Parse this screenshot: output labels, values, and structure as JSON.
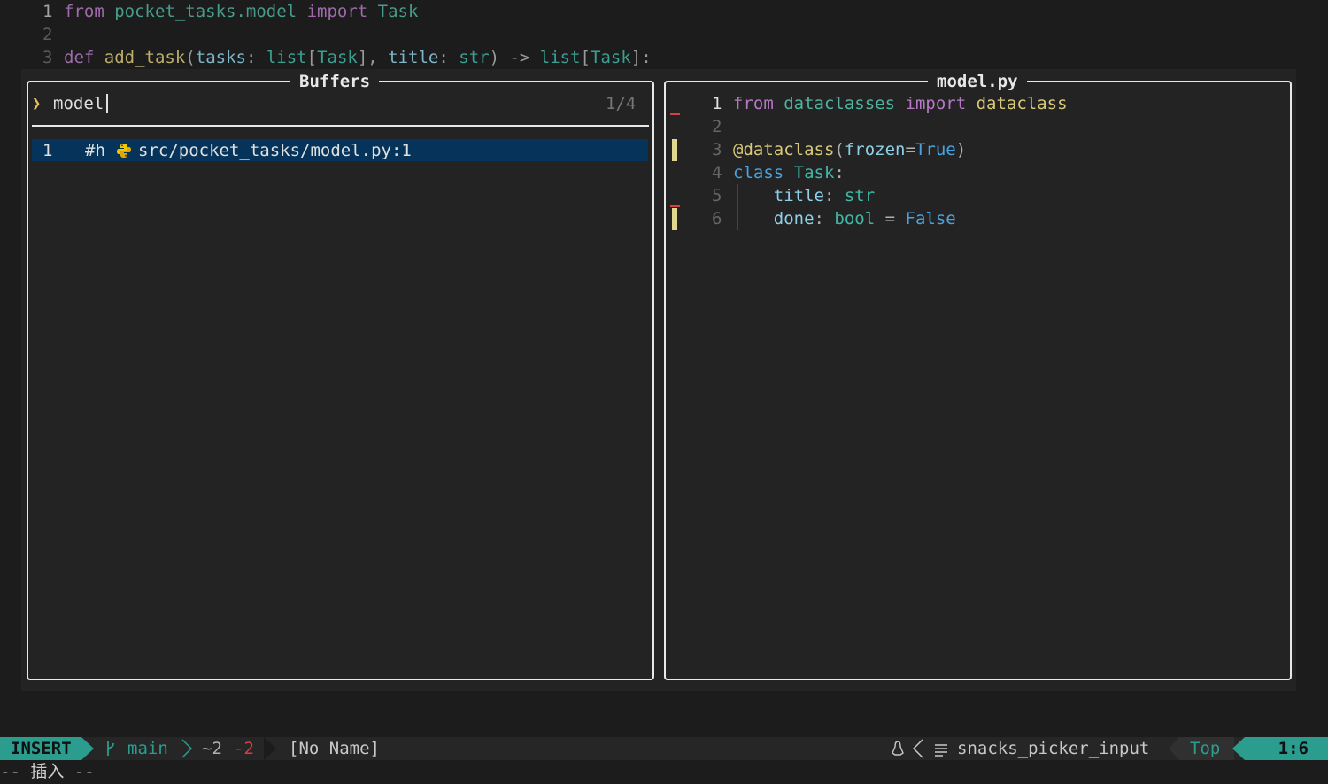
{
  "editor": {
    "lines": [
      {
        "num": "1",
        "tokens": [
          {
            "t": "from",
            "c": "kw"
          },
          {
            "t": " ",
            "c": "id"
          },
          {
            "t": "pocket_tasks.model",
            "c": "mod"
          },
          {
            "t": " ",
            "c": "id"
          },
          {
            "t": "import",
            "c": "kw"
          },
          {
            "t": " ",
            "c": "id"
          },
          {
            "t": "Task",
            "c": "mod"
          }
        ]
      },
      {
        "num": "2",
        "tokens": []
      },
      {
        "num": "3",
        "tokens": [
          {
            "t": "def",
            "c": "kw"
          },
          {
            "t": " ",
            "c": "id"
          },
          {
            "t": "add_task",
            "c": "fn"
          },
          {
            "t": "(",
            "c": "punc"
          },
          {
            "t": "tasks",
            "c": "param"
          },
          {
            "t": ": ",
            "c": "punc"
          },
          {
            "t": "list",
            "c": "ty"
          },
          {
            "t": "[",
            "c": "punc"
          },
          {
            "t": "Task",
            "c": "ty"
          },
          {
            "t": "], ",
            "c": "punc"
          },
          {
            "t": "title",
            "c": "param"
          },
          {
            "t": ": ",
            "c": "punc"
          },
          {
            "t": "str",
            "c": "ty"
          },
          {
            "t": ") -> ",
            "c": "punc"
          },
          {
            "t": "list",
            "c": "ty"
          },
          {
            "t": "[",
            "c": "punc"
          },
          {
            "t": "Task",
            "c": "ty"
          },
          {
            "t": "]:",
            "c": "punc"
          }
        ]
      }
    ]
  },
  "picker": {
    "title": "Buffers",
    "prompt_icon": "❯",
    "query": "model",
    "count": "1/4",
    "results": [
      {
        "index": "1",
        "flags": "#h",
        "icon": "python-icon",
        "path": "src/pocket_tasks/model.py:1"
      }
    ]
  },
  "preview": {
    "title": "model.py",
    "lines": [
      {
        "num": "1",
        "tokens": [
          {
            "t": "from",
            "c": "kw"
          },
          {
            "t": " ",
            "c": "id"
          },
          {
            "t": "dataclasses",
            "c": "mod"
          },
          {
            "t": " ",
            "c": "id"
          },
          {
            "t": "import",
            "c": "kw"
          },
          {
            "t": " ",
            "c": "id"
          },
          {
            "t": "dataclass",
            "c": "fn"
          }
        ]
      },
      {
        "num": "2",
        "tokens": []
      },
      {
        "num": "3",
        "tokens": [
          {
            "t": "@dataclass",
            "c": "fn"
          },
          {
            "t": "(",
            "c": "punc"
          },
          {
            "t": "frozen",
            "c": "param"
          },
          {
            "t": "=",
            "c": "punc"
          },
          {
            "t": "True",
            "c": "const"
          },
          {
            "t": ")",
            "c": "punc"
          }
        ]
      },
      {
        "num": "4",
        "tokens": [
          {
            "t": "class",
            "c": "const"
          },
          {
            "t": " ",
            "c": "id"
          },
          {
            "t": "Task",
            "c": "ty"
          },
          {
            "t": ":",
            "c": "punc"
          }
        ]
      },
      {
        "num": "5",
        "tokens": [
          {
            "t": "    ",
            "c": "id"
          },
          {
            "t": "title",
            "c": "param"
          },
          {
            "t": ": ",
            "c": "punc"
          },
          {
            "t": "str",
            "c": "ty"
          }
        ]
      },
      {
        "num": "6",
        "tokens": [
          {
            "t": "    ",
            "c": "id"
          },
          {
            "t": "done",
            "c": "param"
          },
          {
            "t": ": ",
            "c": "punc"
          },
          {
            "t": "bool",
            "c": "ty"
          },
          {
            "t": " = ",
            "c": "punc"
          },
          {
            "t": "False",
            "c": "const"
          }
        ]
      }
    ]
  },
  "statusline": {
    "mode": "INSERT",
    "branch_icon": "git-branch-icon",
    "branch": "main",
    "diff_changed": "~2",
    "diff_removed": "-2",
    "filename": "[No Name]",
    "os_icon": "linux-icon",
    "filetype_icon": "lines-icon",
    "filetype": "snacks_picker_input",
    "position": "Top",
    "cursor": "1:6"
  },
  "cmdline": {
    "text": "-- 插入 --"
  },
  "colors": {
    "mode_bg": "#2a9d8f",
    "selection_bg": "#053359",
    "diff_removed": "#d64040",
    "git_added_sign": "#e0d890",
    "python_icon": "#f2c500"
  }
}
